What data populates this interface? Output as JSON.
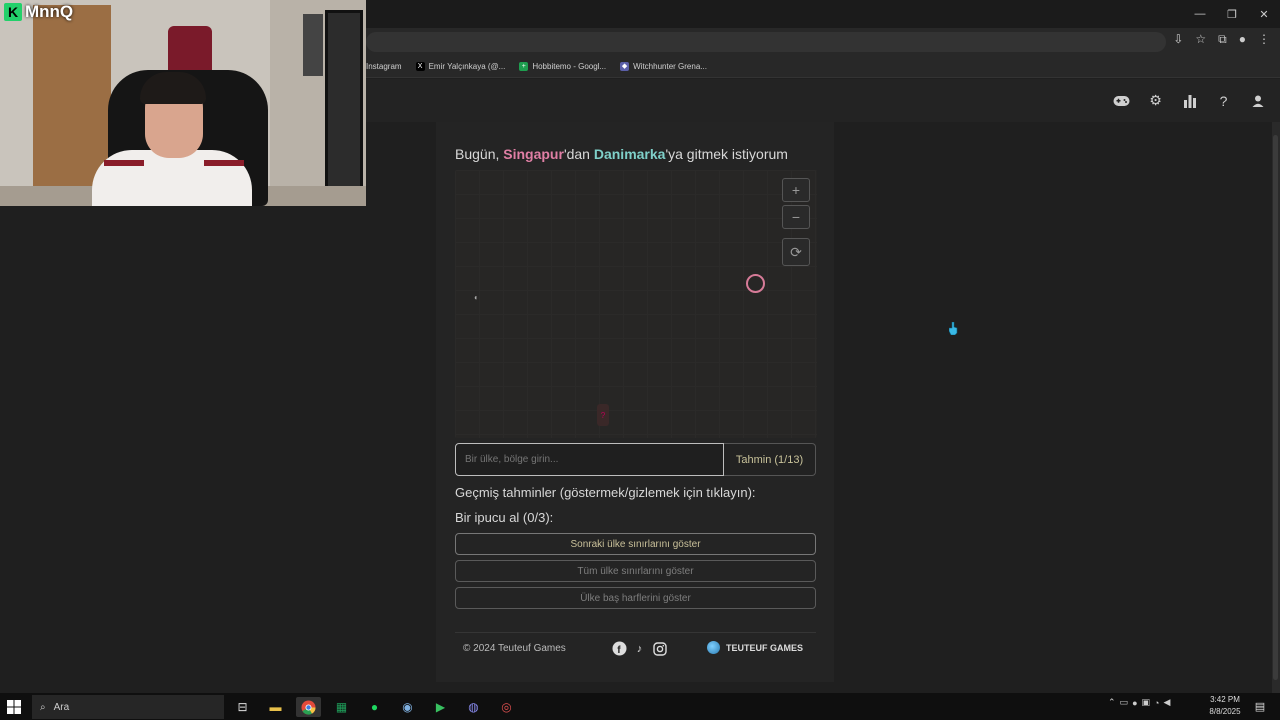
{
  "webcam": {
    "logo_letter": "K",
    "streamer_name": "MnnQ"
  },
  "browser": {
    "bookmarks": [
      {
        "label": "Instagram",
        "icon": "instagram-icon"
      },
      {
        "label": "Emir Yalçınkaya (@...",
        "icon": "x-icon"
      },
      {
        "label": "Hobbitemo - Googl...",
        "icon": "sheets-icon"
      },
      {
        "label": "Witchhunter Grena...",
        "icon": "shield-icon"
      }
    ]
  },
  "nav": {
    "icons": [
      "gamepad-icon",
      "gear-icon",
      "stats-icon",
      "help-icon",
      "user-icon"
    ]
  },
  "game": {
    "prompt_pre": "Bugün, ",
    "from_country": "Singapur",
    "prompt_mid": "'dan ",
    "to_country": "Danimarka",
    "prompt_post": "'ya gitmek istiyorum",
    "from_color": "#e07fa5",
    "to_color": "#7fd0c9",
    "zoom_in": "+",
    "zoom_out": "−",
    "reset": "⟳",
    "input_placeholder": "Bir ülke, bölge girin...",
    "guess_button": "Tahmin (1/13)",
    "history_label": "Geçmiş tahminler (göstermek/gizlemek için tıklayın):",
    "hint_label": "Bir ipucu al (0/3):",
    "hints": [
      "Sonraki ülke sınırlarını göster",
      "Tüm ülke sınırlarını göster",
      "Ülke baş harflerini göster"
    ],
    "map_marker": "?"
  },
  "footer": {
    "copyright": "© 2024 Teuteuf Games",
    "social_icons": [
      "facebook-icon",
      "tiktok-icon",
      "instagram-icon"
    ],
    "brand": "TEUTEUF GAMES"
  },
  "taskbar": {
    "search_label": "Ara",
    "time": "3:42 PM",
    "date": "8/8/2025"
  }
}
